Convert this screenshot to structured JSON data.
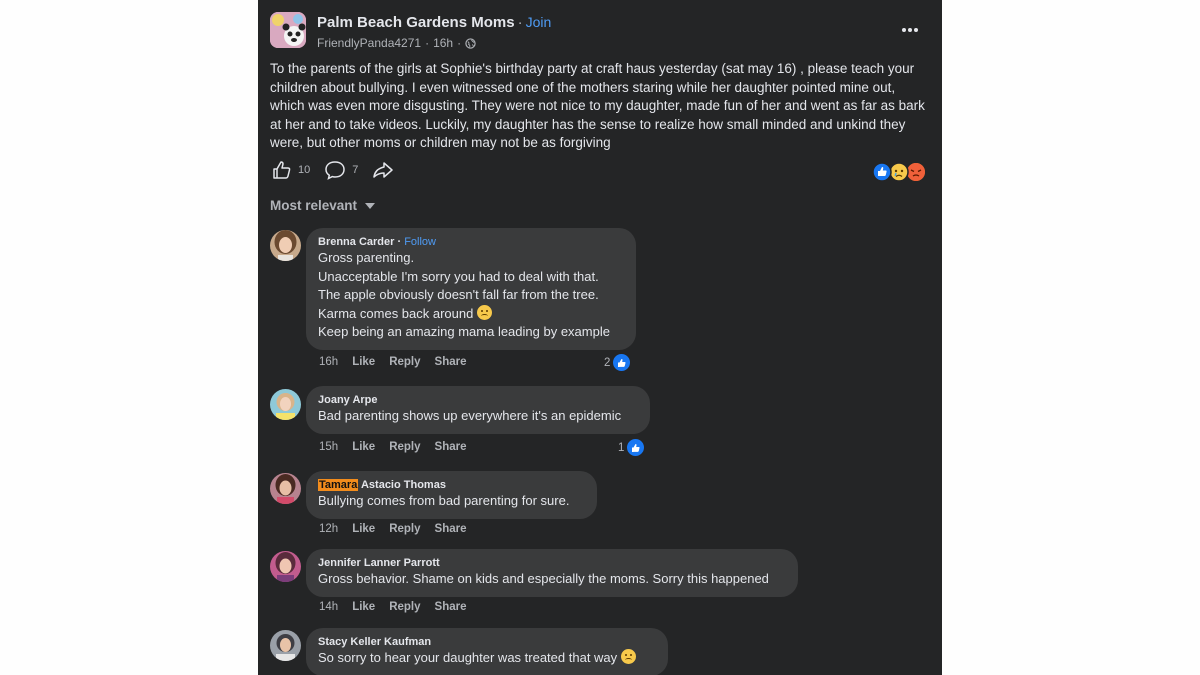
{
  "post": {
    "group_name": "Palm Beach Gardens Moms",
    "join_label": "Join",
    "author": "FriendlyPanda4271",
    "time": "16h",
    "body": "To the parents of the girls at Sophie's birthday party at craft haus yesterday (sat may 16) , please teach your children about bullying. I even witnessed one of the mothers staring while her daughter pointed mine out, which was even more disgusting. They were not nice to my daughter, made fun of her and went as far as bark at her and to take videos. Luckily, my daughter has the sense to realize how small minded and unkind they were, but other moms or children may not be as forgiving",
    "like_count": "10",
    "comment_count": "7",
    "reaction_icons": [
      "like-icon",
      "sad-icon",
      "angry-icon"
    ]
  },
  "sort_label": "Most relevant",
  "comment_actions": {
    "like": "Like",
    "reply": "Reply",
    "share": "Share"
  },
  "comments": [
    {
      "name": "Brenna Carder",
      "follow": "Follow",
      "lines": [
        "Gross parenting.",
        "Unacceptable I'm sorry you had to deal with that.",
        "The apple obviously doesn't fall far from the tree.",
        "Karma comes back around",
        "Keep being an amazing mama leading by example"
      ],
      "time": "16h",
      "likes": "2"
    },
    {
      "name": "Joany Arpe",
      "lines": [
        "Bad parenting shows up everywhere it's an epidemic"
      ],
      "time": "15h",
      "likes": "1"
    },
    {
      "name_highlight": "Tamara",
      "name_rest": " Astacio Thomas",
      "lines": [
        "Bullying comes from bad parenting for sure."
      ],
      "time": "12h"
    },
    {
      "name": "Jennifer Lanner Parrott",
      "lines": [
        "Gross behavior. Shame on kids and especially the moms. Sorry this happened"
      ],
      "time": "14h"
    },
    {
      "name": "Stacy Keller Kaufman",
      "lines": [
        "So sorry to hear your daughter was treated that way"
      ]
    }
  ],
  "colors": {
    "panel": "#242526",
    "bubble": "#3a3b3c",
    "link": "#4f9cf5",
    "like_blue": "#1877f2",
    "highlight": "#f28c1c"
  }
}
